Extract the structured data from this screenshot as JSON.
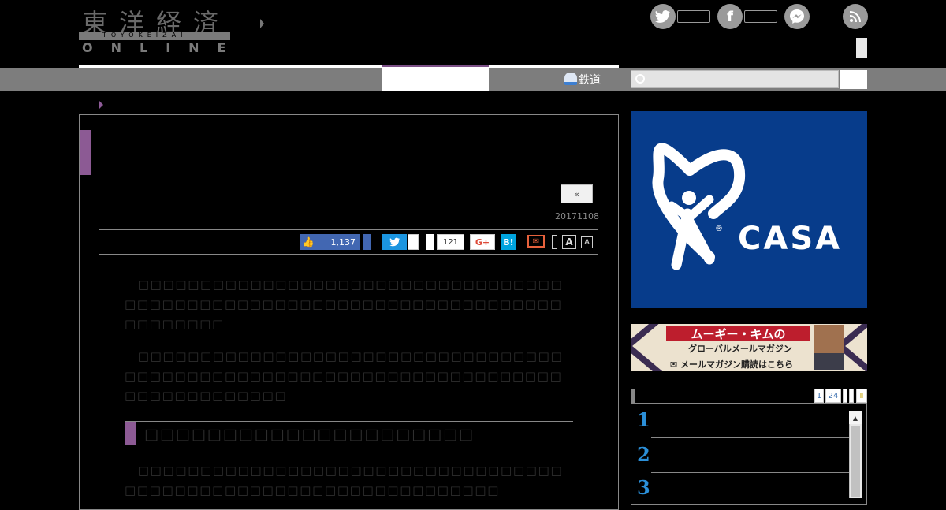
{
  "header": {
    "logo_kanji": "東洋経済",
    "logo_roman": "TOYOKEIZAI",
    "logo_online": "ONLINE",
    "social": [
      "twitter-icon",
      "facebook-icon",
      "messenger-icon",
      "rss-icon"
    ]
  },
  "nav": {
    "rail_label": "鉄道",
    "search_placeholder": ""
  },
  "article": {
    "prev_label": "«",
    "date": "20171108",
    "share": {
      "like_count": "1,137",
      "pocket_count": "121",
      "gplus_label": "G+",
      "hatena_label": "B!"
    },
    "font_large": "A",
    "font_small": "A",
    "paragraph1": "　□□□□□□□□□□□□□□□□□□□□□□□□□□□□□□□□□□□□□□□□□□□□□□□□□□□□□□□□□□□□□□□□□□□□□□□□□□□□□",
    "paragraph2": "　□□□□□□□□□□□□□□□□□□□□□□□□□□□□□□□□□□□□□□□□□□□□□□□□□□□□□□□□□□□□□□□□□□□□□□□□□□□□□□□□□□",
    "heading": "□□□□□□□□□□□□□□□□□□□□□",
    "paragraph3": "　□□□□□□□□□□□□□□□□□□□□□□□□□□□□□□□□□□□□□□□□□□□□□□□□□□□□□□□□□□□□□□□□"
  },
  "sidebar": {
    "ad_brand": "CASA",
    "ad_reg": "®",
    "banner_line1": "ムーギー・キムの",
    "banner_line2": "グローバルメールマガジン",
    "banner_line3": "✉ メールマガジン購読はこちら",
    "rank_tabs": [
      "1",
      "24"
    ],
    "rank_numbers": [
      "1",
      "2",
      "3"
    ],
    "scroll_up": "▲"
  },
  "colors": {
    "accent": "#8c5a94",
    "nav_bg": "#7d7d7d",
    "facebook": "#4267b2",
    "twitter": "#1b95e0",
    "casa_blue": "#073c8b"
  }
}
